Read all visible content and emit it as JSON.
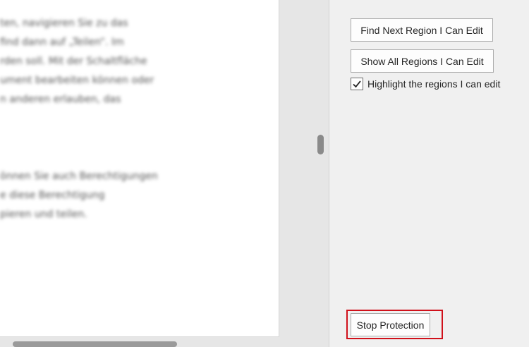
{
  "document": {
    "lines": [
      "ten, navigieren Sie zu das",
      "find dann auf „Teilen“. Im",
      "rden soll. Mit der Schaltfläche",
      "ument bearbeiten können oder",
      "n anderen erlauben, das",
      "önnen Sie auch Berechtigungen",
      "e diese Berechtigung",
      "pieren und teilen."
    ]
  },
  "pane": {
    "find_next_label": "Find Next Region I Can Edit",
    "show_all_label": "Show All Regions I Can Edit",
    "highlight_label": "Highlight the regions I can edit",
    "highlight_checked": true,
    "stop_label": "Stop Protection",
    "highlight_color": "#d0111b"
  }
}
